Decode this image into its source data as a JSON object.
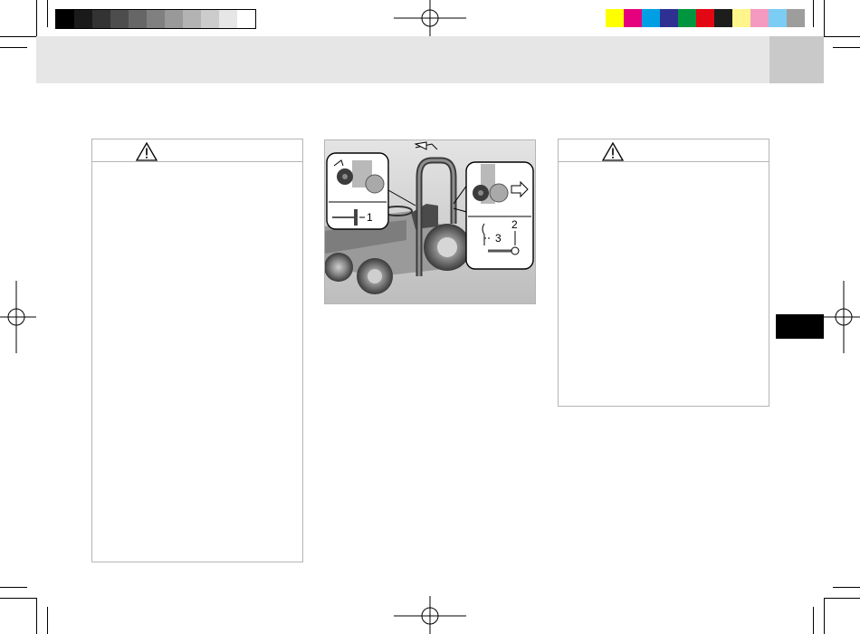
{
  "page": {
    "colors": {
      "grayscale": [
        "#000000",
        "#1a1a1a",
        "#333333",
        "#4d4d4d",
        "#666666",
        "#808080",
        "#999999",
        "#b3b3b3",
        "#cccccc",
        "#e6e6e6",
        "#ffffff"
      ],
      "process": [
        "#ffff00",
        "#e6007e",
        "#009fe3",
        "#2e3192",
        "#009640",
        "#e30613",
        "#1d1d1b",
        "#fff58a",
        "#f49ac1",
        "#7ccdf4",
        "#9d9d9c"
      ],
      "header_band": "#e6e6e6",
      "header_tab": "#c9c9c9",
      "side_tab": "#000000"
    }
  },
  "warning_left": {
    "icon": "warning-triangle-icon"
  },
  "warning_right": {
    "icon": "warning-triangle-icon"
  },
  "figure": {
    "callouts": {
      "c1": "1",
      "c2": "2",
      "c3": "3"
    }
  }
}
